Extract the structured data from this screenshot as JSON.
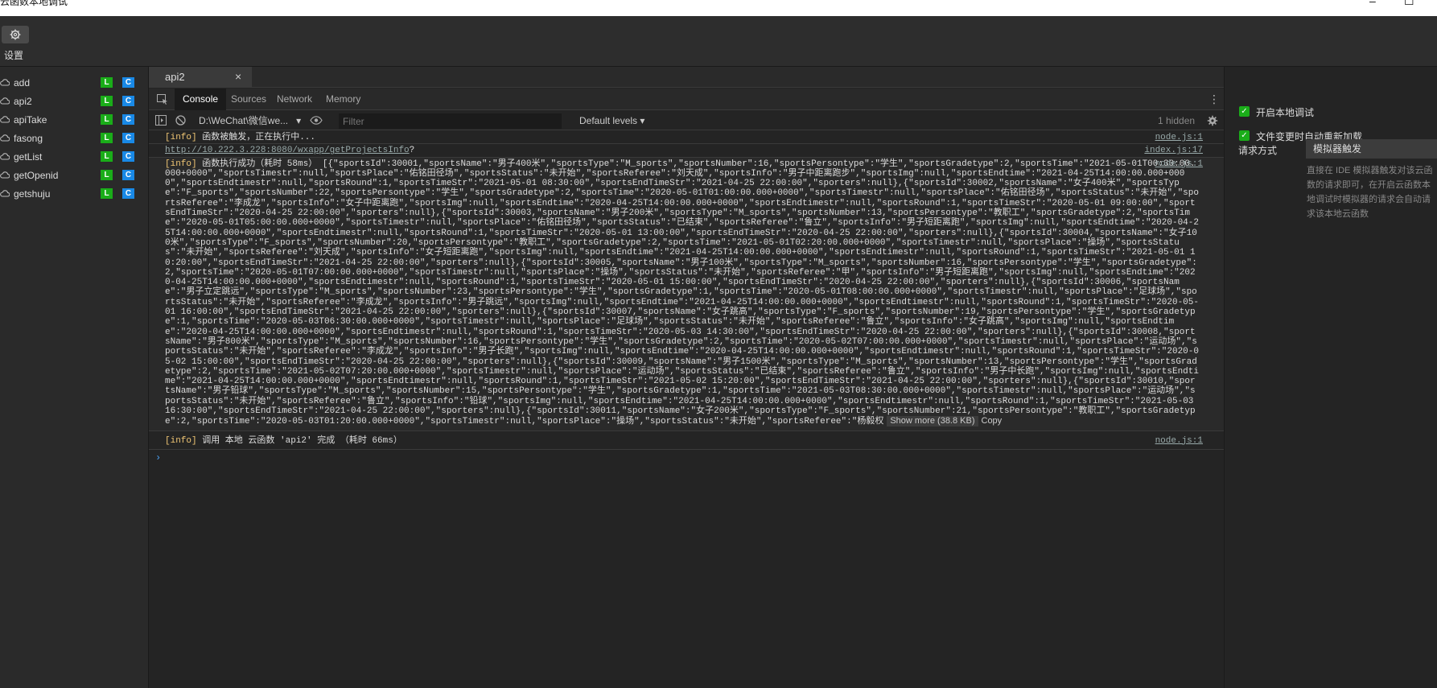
{
  "window": {
    "title": "云函数本地调试",
    "minimize": "–",
    "maximize": "☐"
  },
  "toolbar": {
    "settings_label": "设置"
  },
  "functions": [
    {
      "name": "add",
      "badge_l": "L",
      "badge_c": "C"
    },
    {
      "name": "api2",
      "badge_l": "L",
      "badge_c": "C"
    },
    {
      "name": "apiTake",
      "badge_l": "L",
      "badge_c": "C"
    },
    {
      "name": "fasong",
      "badge_l": "L",
      "badge_c": "C"
    },
    {
      "name": "getList",
      "badge_l": "L",
      "badge_c": "C"
    },
    {
      "name": "getOpenid",
      "badge_l": "L",
      "badge_c": "C"
    },
    {
      "name": "getshuju",
      "badge_l": "L",
      "badge_c": "C"
    }
  ],
  "file_tab": {
    "label": "api2",
    "close": "×"
  },
  "devtools": {
    "tabs": [
      "Console",
      "Sources",
      "Network",
      "Memory"
    ],
    "active_tab": "Console",
    "context": "D:\\WeChat\\微信we...",
    "filter_placeholder": "Filter",
    "levels": "Default levels",
    "hidden": "1 hidden"
  },
  "console": {
    "messages": [
      {
        "tag": "[info]",
        "text": " 函数被触发，正在执行中...",
        "source": "node.js:1"
      },
      {
        "url": "http://10.222.3.228:8080/wxapp/getProjectsInfo",
        "suffix": "?",
        "source": "index.js:17"
      },
      {
        "tag": "[info]",
        "text": " 函数执行成功（耗时 58ms） [{\"sportsId\":30001,\"sportsName\":\"男子400米\",\"sportsType\":\"M_sports\",\"sportsNumber\":16,\"sportsPersontype\":\"学生\",\"sportsGradetype\":2,\"sportsTime\":\"2021-05-01T00:30:00.000+0000\",\"sportsTimestr\":null,\"sportsPlace\":\"佑铭田径场\",\"sportsStatus\":\"未开始\",\"sportsReferee\":\"刘天成\",\"sportsInfo\":\"男子中距离跑步\",\"sportsImg\":null,\"sportsEndtime\":\"2021-04-25T14:00:00.000+0000\",\"sportsEndtimestr\":null,\"sportsRound\":1,\"sportsTimeStr\":\"2021-05-01 08:30:00\",\"sportsEndTimeStr\":\"2021-04-25 22:00:00\",\"sporters\":null},{\"sportsId\":30002,\"sportsName\":\"女子400米\",\"sportsType\":\"F_sports\",\"sportsNumber\":22,\"sportsPersontype\":\"学生\",\"sportsGradetype\":2,\"sportsTime\":\"2020-05-01T01:00:00.000+0000\",\"sportsTimestr\":null,\"sportsPlace\":\"佑铭田径场\",\"sportsStatus\":\"未开始\",\"sportsReferee\":\"李成龙\",\"sportsInfo\":\"女子中距离跑\",\"sportsImg\":null,\"sportsEndtime\":\"2020-04-25T14:00:00.000+0000\",\"sportsEndtimestr\":null,\"sportsRound\":1,\"sportsTimeStr\":\"2020-05-01 09:00:00\",\"sportsEndTimeStr\":\"2020-04-25 22:00:00\",\"sporters\":null},{\"sportsId\":30003,\"sportsName\":\"男子200米\",\"sportsType\":\"M_sports\",\"sportsNumber\":13,\"sportsPersontype\":\"教职工\",\"sportsGradetype\":2,\"sportsTime\":\"2020-05-01T05:00:00.000+0000\",\"sportsTimestr\":null,\"sportsPlace\":\"佑铭田径场\",\"sportsStatus\":\"已结束\",\"sportsReferee\":\"鲁立\",\"sportsInfo\":\"男子短距离跑\",\"sportsImg\":null,\"sportsEndtime\":\"2020-04-25T14:00:00.000+0000\",\"sportsEndtimestr\":null,\"sportsRound\":1,\"sportsTimeStr\":\"2020-05-01 13:00:00\",\"sportsEndTimeStr\":\"2020-04-25 22:00:00\",\"sporters\":null},{\"sportsId\":30004,\"sportsName\":\"女子100米\",\"sportsType\":\"F_sports\",\"sportsNumber\":20,\"sportsPersontype\":\"教职工\",\"sportsGradetype\":2,\"sportsTime\":\"2021-05-01T02:20:00.000+0000\",\"sportsTimestr\":null,\"sportsPlace\":\"操场\",\"sportsStatus\":\"未开始\",\"sportsReferee\":\"刘天成\",\"sportsInfo\":\"女子短距离跑\",\"sportsImg\":null,\"sportsEndtime\":\"2021-04-25T14:00:00.000+0000\",\"sportsEndtimestr\":null,\"sportsRound\":1,\"sportsTimeStr\":\"2021-05-01 10:20:00\",\"sportsEndTimeStr\":\"2021-04-25 22:00:00\",\"sporters\":null},{\"sportsId\":30005,\"sportsName\":\"男子100米\",\"sportsType\":\"M_sports\",\"sportsNumber\":16,\"sportsPersontype\":\"学生\",\"sportsGradetype\":2,\"sportsTime\":\"2020-05-01T07:00:00.000+0000\",\"sportsTimestr\":null,\"sportsPlace\":\"操场\",\"sportsStatus\":\"未开始\",\"sportsReferee\":\"甲\",\"sportsInfo\":\"男子短距离跑\",\"sportsImg\":null,\"sportsEndtime\":\"2020-04-25T14:00:00.000+0000\",\"sportsEndtimestr\":null,\"sportsRound\":1,\"sportsTimeStr\":\"2020-05-01 15:00:00\",\"sportsEndTimeStr\":\"2020-04-25 22:00:00\",\"sporters\":null},{\"sportsId\":30006,\"sportsName\":\"男子立定跳远\",\"sportsType\":\"M_sports\",\"sportsNumber\":23,\"sportsPersontype\":\"学生\",\"sportsGradetype\":1,\"sportsTime\":\"2020-05-01T08:00:00.000+0000\",\"sportsTimestr\":null,\"sportsPlace\":\"足球场\",\"sportsStatus\":\"未开始\",\"sportsReferee\":\"李成龙\",\"sportsInfo\":\"男子跳远\",\"sportsImg\":null,\"sportsEndtime\":\"2021-04-25T14:00:00.000+0000\",\"sportsEndtimestr\":null,\"sportsRound\":1,\"sportsTimeStr\":\"2020-05-01 16:00:00\",\"sportsEndTimeStr\":\"2021-04-25 22:00:00\",\"sporters\":null},{\"sportsId\":30007,\"sportsName\":\"女子跳高\",\"sportsType\":\"F_sports\",\"sportsNumber\":19,\"sportsPersontype\":\"学生\",\"sportsGradetype\":1,\"sportsTime\":\"2020-05-03T06:30:00.000+0000\",\"sportsTimestr\":null,\"sportsPlace\":\"足球场\",\"sportsStatus\":\"未开始\",\"sportsReferee\":\"鲁立\",\"sportsInfo\":\"女子跳高\",\"sportsImg\":null,\"sportsEndtime\":\"2020-04-25T14:00:00.000+0000\",\"sportsEndtimestr\":null,\"sportsRound\":1,\"sportsTimeStr\":\"2020-05-03 14:30:00\",\"sportsEndTimeStr\":\"2020-04-25 22:00:00\",\"sporters\":null},{\"sportsId\":30008,\"sportsName\":\"男子800米\",\"sportsType\":\"M_sports\",\"sportsNumber\":16,\"sportsPersontype\":\"学生\",\"sportsGradetype\":2,\"sportsTime\":\"2020-05-02T07:00:00.000+0000\",\"sportsTimestr\":null,\"sportsPlace\":\"运动场\",\"sportsStatus\":\"未开始\",\"sportsReferee\":\"李成龙\",\"sportsInfo\":\"男子长跑\",\"sportsImg\":null,\"sportsEndtime\":\"2020-04-25T14:00:00.000+0000\",\"sportsEndtimestr\":null,\"sportsRound\":1,\"sportsTimeStr\":\"2020-05-02 15:00:00\",\"sportsEndTimeStr\":\"2020-04-25 22:00:00\",\"sporters\":null},{\"sportsId\":30009,\"sportsName\":\"男子1500米\",\"sportsType\":\"M_sports\",\"sportsNumber\":13,\"sportsPersontype\":\"学生\",\"sportsGradetype\":2,\"sportsTime\":\"2021-05-02T07:20:00.000+0000\",\"sportsTimestr\":null,\"sportsPlace\":\"运动场\",\"sportsStatus\":\"已结束\",\"sportsReferee\":\"鲁立\",\"sportsInfo\":\"男子中长跑\",\"sportsImg\":null,\"sportsEndtime\":\"2021-04-25T14:00:00.000+0000\",\"sportsEndtimestr\":null,\"sportsRound\":1,\"sportsTimeStr\":\"2021-05-02 15:20:00\",\"sportsEndTimeStr\":\"2021-04-25 22:00:00\",\"sporters\":null},{\"sportsId\":30010,\"sportsName\":\"男子铅球\",\"sportsType\":\"M_sports\",\"sportsNumber\":15,\"sportsPersontype\":\"学生\",\"sportsGradetype\":1,\"sportsTime\":\"2021-05-03T08:30:00.000+0000\",\"sportsTimestr\":null,\"sportsPlace\":\"运动场\",\"sportsStatus\":\"未开始\",\"sportsReferee\":\"鲁立\",\"sportsInfo\":\"铅球\",\"sportsImg\":null,\"sportsEndtime\":\"2021-04-25T14:00:00.000+0000\",\"sportsEndtimestr\":null,\"sportsRound\":1,\"sportsTimeStr\":\"2021-05-03 16:30:00\",\"sportsEndTimeStr\":\"2021-04-25 22:00:00\",\"sporters\":null},{\"sportsId\":30011,\"sportsName\":\"女子200米\",\"sportsType\":\"F_sports\",\"sportsNumber\":21,\"sportsPersontype\":\"教职工\",\"sportsGradetype\":2,\"sportsTime\":\"2020-05-03T01:20:00.000+0000\",\"sportsTimestr\":null,\"sportsPlace\":\"操场\",\"sportsStatus\":\"未开始\",\"sportsReferee\":\"杨毅权",
        "source": "node.js:1",
        "show_more": "Show more (38.8 KB)",
        "copy": "Copy"
      },
      {
        "tag": "[info]",
        "text": " 调用 本地 云函数 'api2' 完成  （耗时 66ms）",
        "source": "node.js:1"
      }
    ],
    "prompt": "›"
  },
  "right_panel": {
    "option_local_debug": "开启本地调试",
    "option_reload": "文件变更时自动重新加载",
    "request_mode_label": "请求方式",
    "request_mode_value": "模拟器触发",
    "description": "直接在 IDE 模拟器触发对该云函数的请求即可，在开启云函数本地调试时模拟器的请求会自动请求该本地云函数"
  },
  "colors": {
    "badge_l": "#1aad19",
    "badge_c": "#1989e6",
    "info_tag": "#f0c674",
    "checkbox": "#1aad19"
  }
}
